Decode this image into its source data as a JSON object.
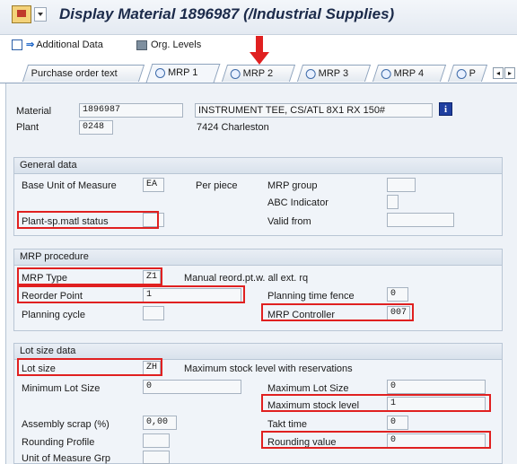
{
  "title": "Display Material 1896987 (/Industrial Supplies)",
  "toolbar": {
    "additional_data": "Additional Data",
    "org_levels": "Org. Levels"
  },
  "tabs": [
    "Purchase order text",
    "MRP 1",
    "MRP 2",
    "MRP 3",
    "MRP 4",
    "P"
  ],
  "header": {
    "material_label": "Material",
    "material_value": "1896987",
    "material_desc": "INSTRUMENT TEE, CS/ATL 8X1 RX 150#",
    "plant_label": "Plant",
    "plant_value": "0248",
    "plant_desc": "7424 Charleston"
  },
  "general": {
    "title": "General data",
    "base_uom_label": "Base Unit of Measure",
    "base_uom_value": "EA",
    "base_uom_desc": "Per piece",
    "mrp_group_label": "MRP group",
    "abc_label": "ABC Indicator",
    "plant_status_label": "Plant-sp.matl status",
    "valid_from_label": "Valid from"
  },
  "mrp": {
    "title": "MRP procedure",
    "mrp_type_label": "MRP Type",
    "mrp_type_value": "Z1",
    "mrp_type_desc": "Manual reord.pt.w. all ext. rq",
    "reorder_label": "Reorder Point",
    "reorder_value": "1",
    "ptf_label": "Planning time fence",
    "ptf_value": "0",
    "cycle_label": "Planning cycle",
    "controller_label": "MRP Controller",
    "controller_value": "007"
  },
  "lot": {
    "title": "Lot size data",
    "lot_size_label": "Lot size",
    "lot_size_value": "ZH",
    "lot_size_desc": "Maximum stock level with reservations",
    "min_label": "Minimum Lot Size",
    "min_value": "0",
    "max_lot_label": "Maximum Lot Size",
    "max_lot_value": "0",
    "max_stock_label": "Maximum stock level",
    "max_stock_value": "1",
    "scrap_label": "Assembly scrap (%)",
    "scrap_value": "0,00",
    "takt_label": "Takt time",
    "takt_value": "0",
    "rounding_profile_label": "Rounding Profile",
    "rounding_value_label": "Rounding value",
    "rounding_value": "0",
    "uom_grp_label": "Unit of Measure Grp"
  },
  "colors": {
    "highlight": "#e02020",
    "title": "#1b2a4a"
  }
}
